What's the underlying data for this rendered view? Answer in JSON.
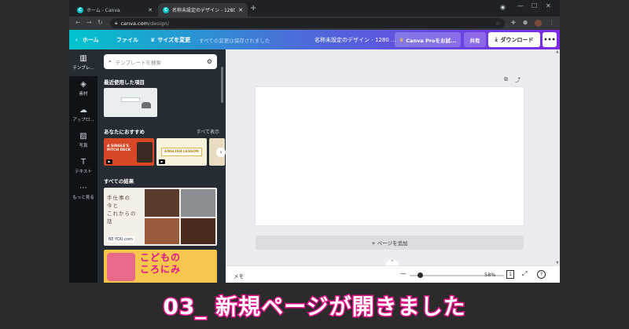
{
  "browser": {
    "tabs": [
      {
        "label": "ホーム - Canva"
      },
      {
        "label": "名称未設定のデザイン - 1280 px ×"
      }
    ],
    "url_host": "canva.com",
    "url_path": "/design/"
  },
  "header": {
    "home": "ホーム",
    "file": "ファイル",
    "resize": "サイズを変更",
    "saved": "すべての変更は保存されました",
    "doc_title": "名称未設定のデザイン - 1280 ...",
    "pro": "Canva Proをお試...",
    "share": "共有",
    "download": "ダウンロード"
  },
  "rail": {
    "items": [
      {
        "label": "テンプレ...",
        "icon": "template-icon"
      },
      {
        "label": "素材",
        "icon": "elements-icon"
      },
      {
        "label": "アップロ...",
        "icon": "upload-icon"
      },
      {
        "label": "写真",
        "icon": "photo-icon"
      },
      {
        "label": "テキスト",
        "icon": "text-icon"
      },
      {
        "label": "もっと見る",
        "icon": "more-icon"
      }
    ]
  },
  "panel": {
    "search_placeholder": "テンプレートを検索",
    "recent_title": "最近使用した項目",
    "recommend_title": "あなたにおすすめ",
    "show_all": "すべて表示",
    "all_results_title": "すべての結果",
    "thumb_pitch_1": "A SINGLE'S",
    "thumb_pitch_2": "PITCH DECK",
    "thumb_lesson": "ENGLISH LESSON",
    "thumb_craft_1": "手仕事の",
    "thumb_craft_2": "今と",
    "thumb_craft_3": "これからの",
    "thumb_craft_4": "話",
    "thumb_craft_brand": "BE YOU.com",
    "thumb_kids_1": "こどもの",
    "thumb_kids_2": "ころにみ"
  },
  "canvas": {
    "add_page": "+ ページを追加"
  },
  "footer": {
    "notes": "メモ",
    "zoom": "58%",
    "page_count": "1",
    "help": "?"
  },
  "caption": "03_ 新規ページが開きました",
  "colors": {
    "accent_pink": "#e0148a",
    "header_start": "#00c4cc",
    "header_end": "#7d2ae8"
  }
}
